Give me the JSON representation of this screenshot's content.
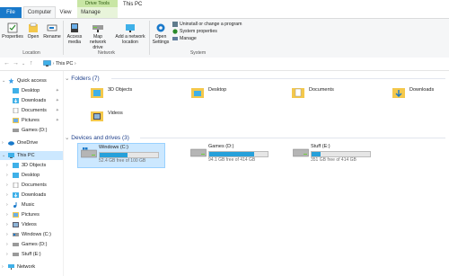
{
  "window": {
    "title": "This PC",
    "contextual_group": "Drive Tools"
  },
  "tabs": [
    {
      "label": "File"
    },
    {
      "label": "Computer"
    },
    {
      "label": "View"
    },
    {
      "label": "Manage"
    }
  ],
  "ribbon": {
    "location_group": {
      "label": "Location",
      "buttons": [
        {
          "label": "Properties",
          "icon": "properties-icon"
        },
        {
          "label": "Open",
          "icon": "open-icon"
        },
        {
          "label": "Rename",
          "icon": "rename-icon"
        }
      ]
    },
    "network_group": {
      "label": "Network",
      "buttons": [
        {
          "label": "Access media",
          "icon": "media-icon"
        },
        {
          "label": "Map network drive",
          "icon": "network-drive-icon"
        },
        {
          "label": "Add a network location",
          "icon": "network-location-icon"
        }
      ]
    },
    "system_group": {
      "label": "System",
      "open_settings": "Open Settings",
      "commands": [
        {
          "label": "Uninstall or change a program",
          "icon": "uninstall-icon"
        },
        {
          "label": "System properties",
          "icon": "system-properties-icon"
        },
        {
          "label": "Manage",
          "icon": "manage-icon"
        }
      ]
    }
  },
  "address": {
    "path": "This PC",
    "separator": "›"
  },
  "nav": {
    "quick_access": "Quick access",
    "quick_items": [
      {
        "label": "Desktop",
        "icon": "desktop-folder-icon"
      },
      {
        "label": "Downloads",
        "icon": "downloads-folder-icon"
      },
      {
        "label": "Documents",
        "icon": "documents-folder-icon"
      },
      {
        "label": "Pictures",
        "icon": "pictures-folder-icon"
      },
      {
        "label": "Games (D:)",
        "icon": "drive-icon"
      }
    ],
    "onedrive": "OneDrive",
    "this_pc": "This PC",
    "pc_items": [
      {
        "label": "3D Objects",
        "icon": "3d-objects-icon"
      },
      {
        "label": "Desktop",
        "icon": "desktop-folder-icon"
      },
      {
        "label": "Documents",
        "icon": "documents-folder-icon"
      },
      {
        "label": "Downloads",
        "icon": "downloads-folder-icon"
      },
      {
        "label": "Music",
        "icon": "music-folder-icon"
      },
      {
        "label": "Pictures",
        "icon": "pictures-folder-icon"
      },
      {
        "label": "Videos",
        "icon": "videos-folder-icon"
      },
      {
        "label": "Windows (C:)",
        "icon": "windows-drive-icon"
      },
      {
        "label": "Games (D:)",
        "icon": "drive-icon"
      },
      {
        "label": "Stuff (E:)",
        "icon": "drive-icon"
      }
    ],
    "network": "Network"
  },
  "content": {
    "folders_header": "Folders (7)",
    "folders": [
      {
        "label": "3D Objects",
        "icon": "3d-objects-icon"
      },
      {
        "label": "Desktop",
        "icon": "desktop-folder-icon"
      },
      {
        "label": "Documents",
        "icon": "documents-folder-icon"
      },
      {
        "label": "Downloads",
        "icon": "downloads-folder-icon"
      },
      {
        "label": "Videos",
        "icon": "videos-folder-icon"
      }
    ],
    "drives_header": "Devices and drives (3)",
    "drives": [
      {
        "label": "Windows (C:)",
        "free": "52.4 GB free of 100 GB",
        "used_fraction": 0.48
      },
      {
        "label": "Games (D:)",
        "free": "94.1 GB free of 414 GB",
        "used_fraction": 0.77
      },
      {
        "label": "Stuff (E:)",
        "free": "351 GB free of 414 GB",
        "used_fraction": 0.15
      }
    ]
  },
  "colors": {
    "accent": "#1979ca",
    "selection": "#cce8ff",
    "drive_bar": "#26a0da",
    "header_text": "#1e3f8a",
    "folder_yellow": "#f4c84b"
  }
}
